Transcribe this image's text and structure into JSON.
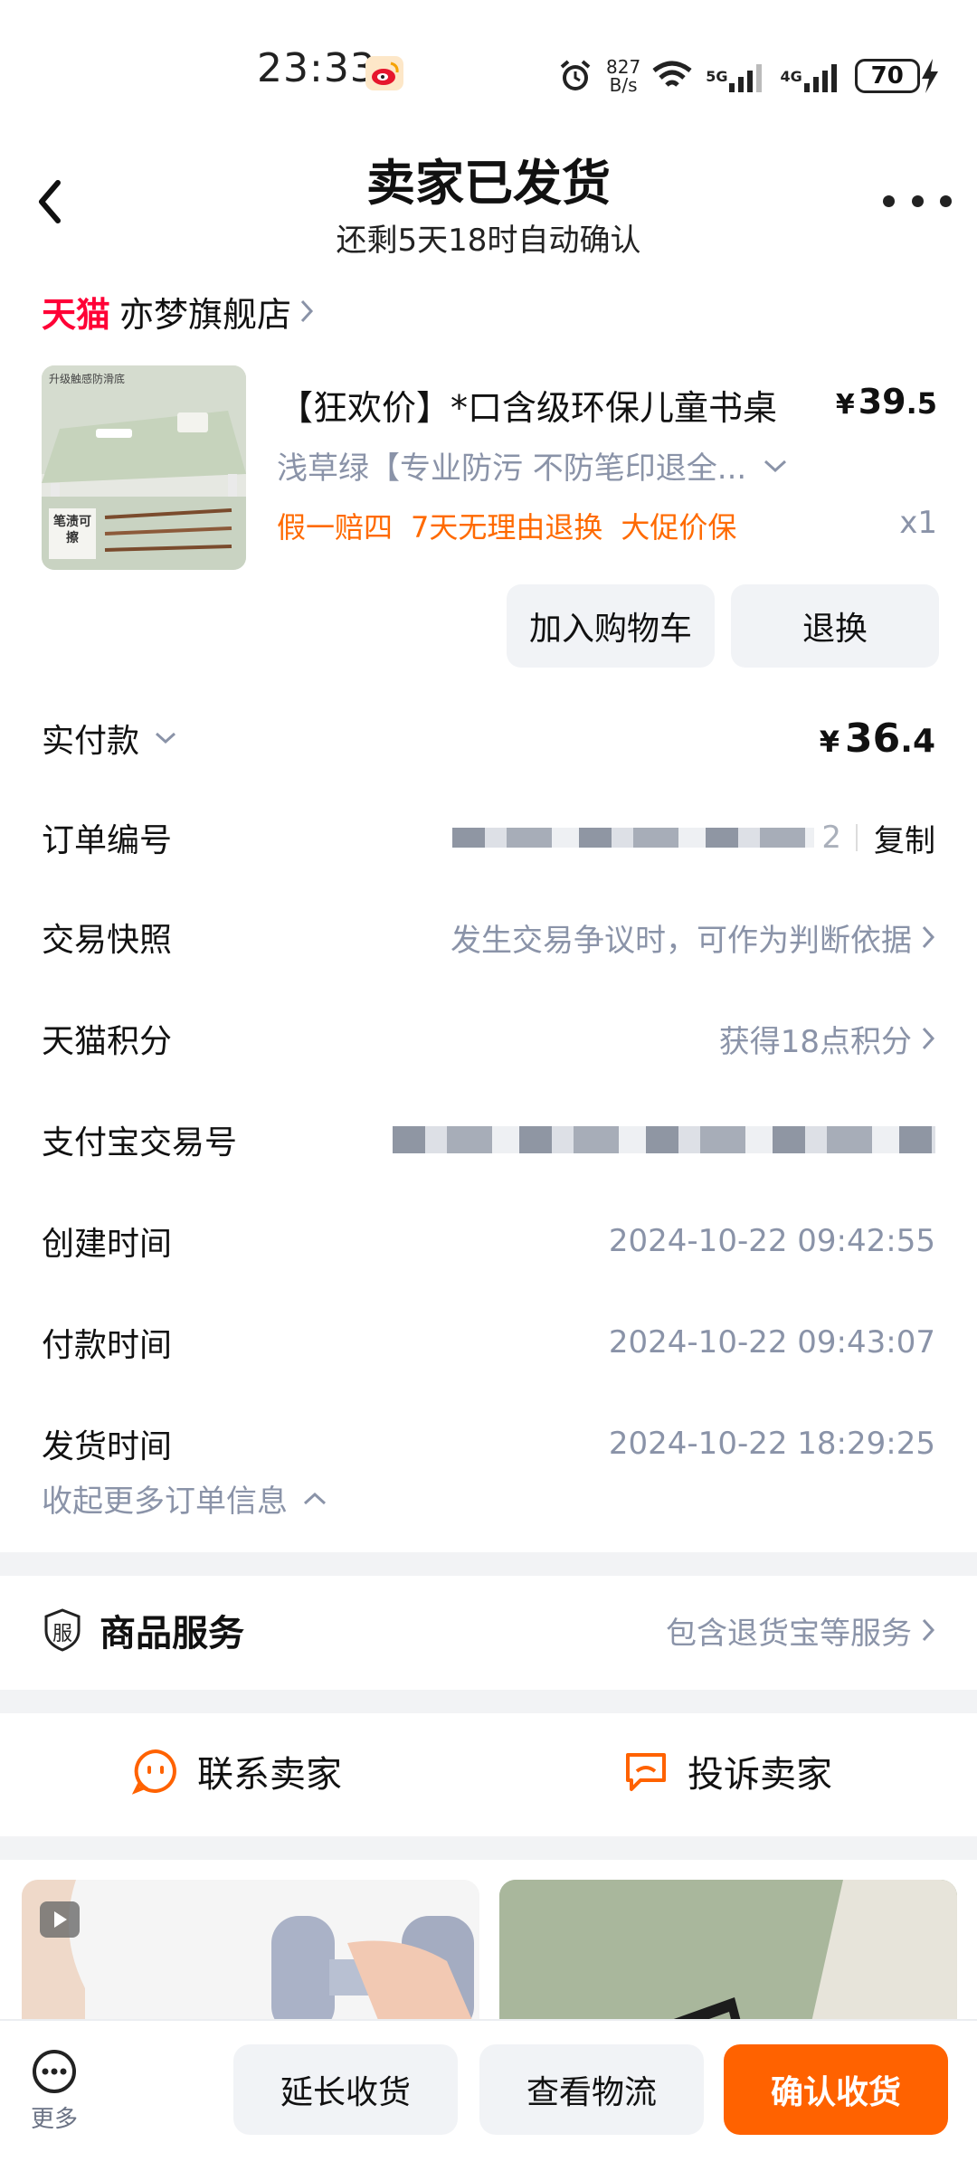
{
  "status_bar": {
    "time": "23:33",
    "net_speed_top": "827",
    "net_speed_bottom": "B/s",
    "tag_5g": "5G",
    "tag_4g": "4G",
    "battery": "70",
    "icons": [
      "weibo-icon",
      "alarm-icon",
      "wifi-icon",
      "signal-icon",
      "battery-icon",
      "charging-icon"
    ]
  },
  "header": {
    "title": "卖家已发货",
    "subtitle": "还剩5天18时自动确认"
  },
  "shop": {
    "brand": "天猫",
    "name": "亦梦旗舰店"
  },
  "product": {
    "title": "【狂欢价】*口含级环保儿童书桌",
    "price_symbol": "¥",
    "price_int": "39",
    "price_dec": ".5",
    "sku": "浅草绿【专业防污 不防笔印退全...",
    "tags": [
      "假一赔四",
      "7天无理由退换",
      "大促价保"
    ],
    "quantity": "x1",
    "image_caption_top": "升级触感防滑底",
    "image_caption_badge": "笔渍可擦",
    "add_cart_label": "加入购物车",
    "return_label": "退换"
  },
  "order_info": {
    "paid": {
      "label": "实付款",
      "symbol": "¥",
      "int": "36",
      "dec": ".4"
    },
    "order_no": {
      "label": "订单编号",
      "value_fragment": "2",
      "copy_label": "复制"
    },
    "snapshot": {
      "label": "交易快照",
      "value": "发生交易争议时，可作为判断依据"
    },
    "points": {
      "label": "天猫积分",
      "value": "获得18点积分"
    },
    "alipay": {
      "label": "支付宝交易号"
    },
    "created": {
      "label": "创建时间",
      "value": "2024-10-22 09:42:55"
    },
    "paid_time": {
      "label": "付款时间",
      "value": "2024-10-22 09:43:07"
    },
    "shipped": {
      "label": "发货时间",
      "value": "2024-10-22 18:29:25"
    },
    "collapse_label": "收起更多订单信息"
  },
  "service": {
    "icon_text": "服",
    "title": "商品服务",
    "value": "包含退货宝等服务"
  },
  "contact": {
    "seller": "联系卖家",
    "complain": "投诉卖家"
  },
  "bottom_bar": {
    "more": "更多",
    "extend": "延长收货",
    "logistics": "查看物流",
    "confirm": "确认收货"
  },
  "colors": {
    "tmall_red": "#ff0036",
    "accent_orange": "#ff6200",
    "muted_text": "#8a93a8",
    "button_gray": "#f1f3f6"
  }
}
